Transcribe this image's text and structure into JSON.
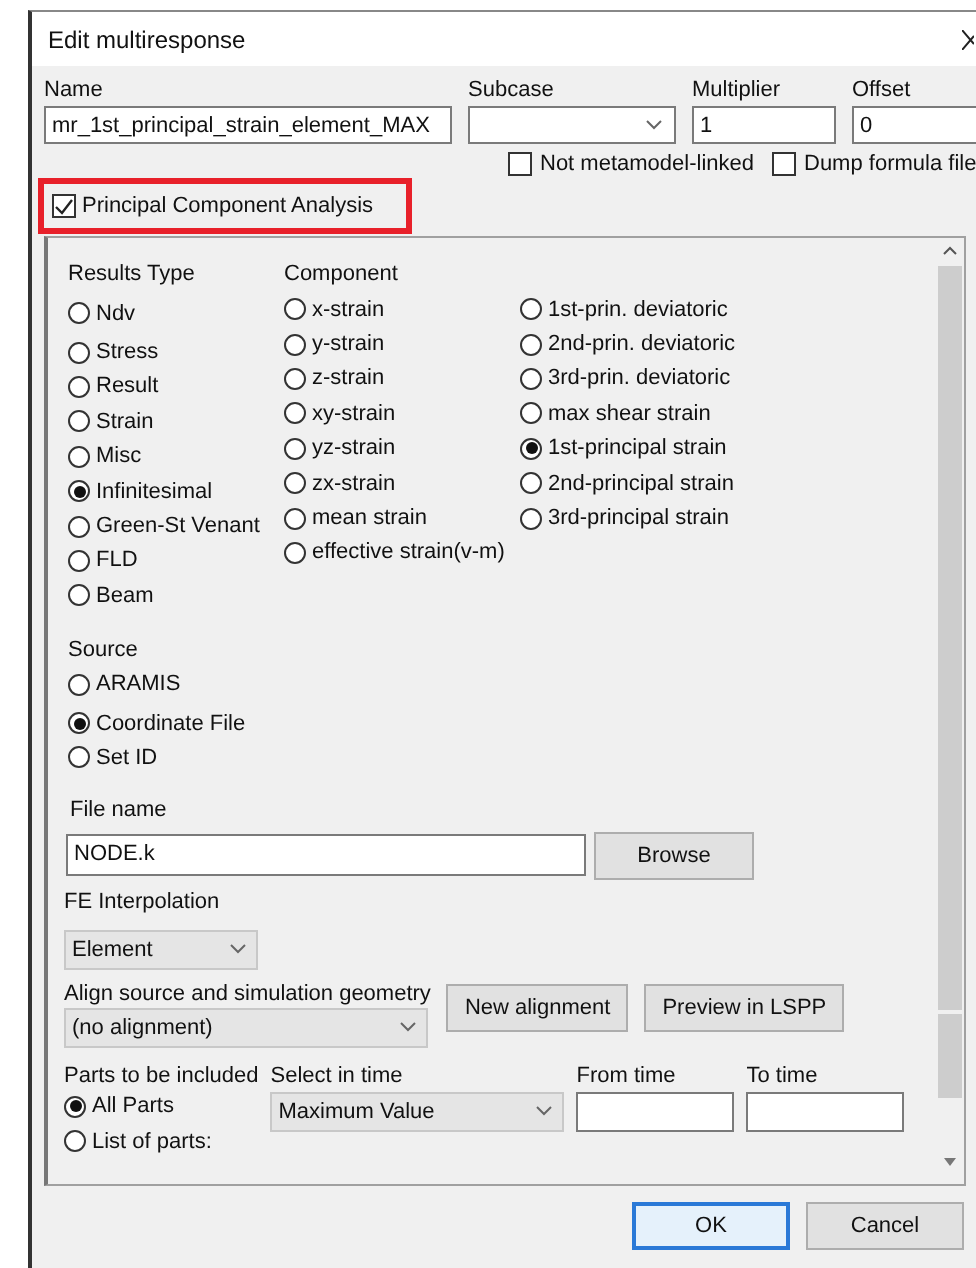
{
  "window": {
    "title": "Edit multiresponse"
  },
  "name_field": {
    "label": "Name",
    "value": "mr_1st_principal_strain_element_MAX"
  },
  "subcase": {
    "label": "Subcase"
  },
  "multiplier": {
    "label": "Multiplier",
    "value": "1"
  },
  "offset": {
    "label": "Offset",
    "value": "0"
  },
  "options": [
    {
      "label": "Not metamodel-linked",
      "checked": false
    },
    {
      "label": "Dump formula file",
      "checked": false
    }
  ],
  "pca": {
    "label": "Principal Component Analysis",
    "checked": true,
    "highlighted": true
  },
  "results_type": {
    "heading": "Results Type",
    "options": [
      {
        "label": "Ndv",
        "selected": false
      },
      {
        "label": "Stress",
        "selected": false
      },
      {
        "label": "Result",
        "selected": false
      },
      {
        "label": "Strain",
        "selected": false
      },
      {
        "label": "Misc",
        "selected": false
      },
      {
        "label": "Infinitesimal",
        "selected": true
      },
      {
        "label": "Green-St Venant",
        "selected": false
      },
      {
        "label": "FLD",
        "selected": false
      },
      {
        "label": "Beam",
        "selected": false
      }
    ]
  },
  "component": {
    "heading": "Component",
    "options": [
      {
        "label": "x-strain",
        "selected": false
      },
      {
        "label": "y-strain",
        "selected": false
      },
      {
        "label": "z-strain",
        "selected": false
      },
      {
        "label": "xy-strain",
        "selected": false
      },
      {
        "label": "yz-strain",
        "selected": false
      },
      {
        "label": "zx-strain",
        "selected": false
      },
      {
        "label": "mean strain",
        "selected": false
      },
      {
        "label": "effective strain(v-m)",
        "selected": false
      },
      {
        "label": "1st-prin. deviatoric",
        "selected": false
      },
      {
        "label": "2nd-prin. deviatoric",
        "selected": false
      },
      {
        "label": "3rd-prin. deviatoric",
        "selected": false
      },
      {
        "label": "max shear strain",
        "selected": false
      },
      {
        "label": "1st-principal strain",
        "selected": true
      },
      {
        "label": "2nd-principal strain",
        "selected": false
      },
      {
        "label": "3rd-principal strain",
        "selected": false
      }
    ]
  },
  "source": {
    "heading": "Source",
    "options": [
      {
        "label": "ARAMIS",
        "selected": false
      },
      {
        "label": "Coordinate File",
        "selected": true
      },
      {
        "label": "Set ID",
        "selected": false
      }
    ]
  },
  "file_name": {
    "label": "File name",
    "value": "NODE.k",
    "button": "Browse"
  },
  "fe_interpolation": {
    "label": "FE Interpolation",
    "value": "Element"
  },
  "alignment": {
    "label": "Align source and simulation geometry",
    "value": "(no alignment)",
    "buttons": [
      "New alignment",
      "Preview in LSPP"
    ]
  },
  "parts": {
    "label": "Parts to be included",
    "options": [
      {
        "label": "All Parts",
        "selected": true
      },
      {
        "label": "List of parts:",
        "selected": false
      }
    ]
  },
  "select_in_time": {
    "label": "Select in time",
    "value": "Maximum Value"
  },
  "from_time": {
    "label": "From time"
  },
  "to_time": {
    "label": "To time"
  },
  "buttons": [
    {
      "label": "OK",
      "default": true
    },
    {
      "label": "Cancel",
      "default": false
    }
  ]
}
